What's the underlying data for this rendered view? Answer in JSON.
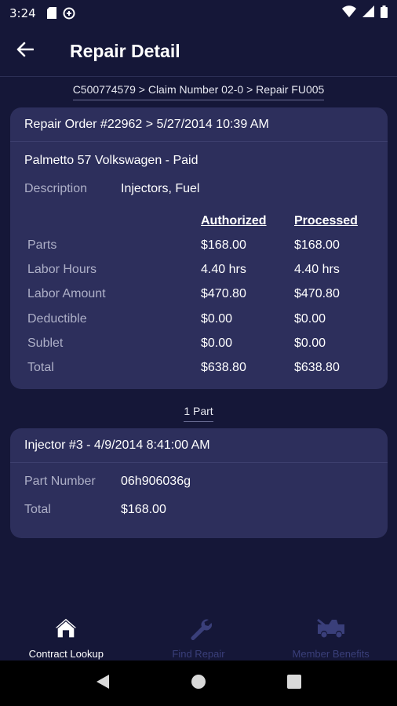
{
  "status_bar": {
    "time": "3:24"
  },
  "app_bar": {
    "title": "Repair Detail"
  },
  "breadcrumb": "C500774579 > Claim Number 02-0 > Repair FU005",
  "repair_order": {
    "header": "Repair Order #22962 > 5/27/2014 10:39 AM",
    "shop": "Palmetto 57 Volkswagen - Paid",
    "description_label": "Description",
    "description_value": "Injectors, Fuel",
    "columns": {
      "authorized": "Authorized",
      "processed": "Processed"
    },
    "rows": [
      {
        "label": "Parts",
        "authorized": "$168.00",
        "processed": "$168.00"
      },
      {
        "label": "Labor Hours",
        "authorized": "4.40 hrs",
        "processed": "4.40 hrs"
      },
      {
        "label": "Labor Amount",
        "authorized": "$470.80",
        "processed": "$470.80"
      },
      {
        "label": "Deductible",
        "authorized": "$0.00",
        "processed": "$0.00"
      },
      {
        "label": "Sublet",
        "authorized": "$0.00",
        "processed": "$0.00"
      },
      {
        "label": "Total",
        "authorized": "$638.80",
        "processed": "$638.80"
      }
    ]
  },
  "parts_section": {
    "label": "1 Part"
  },
  "part": {
    "header": "Injector #3 - 4/9/2014 8:41:00 AM",
    "part_number_label": "Part Number",
    "part_number_value": "06h906036g",
    "total_label": "Total",
    "total_value": "$168.00"
  },
  "bottom_nav": {
    "items": [
      {
        "label": "Contract Lookup",
        "icon": "home-icon",
        "active": true
      },
      {
        "label": "Find Repair",
        "icon": "wrench-icon",
        "active": false
      },
      {
        "label": "Member Benefits",
        "icon": "tow-truck-icon",
        "active": false
      }
    ]
  },
  "colors": {
    "background": "#151738",
    "card": "#2d2f5c",
    "muted_text": "#aeb0c8",
    "inactive_nav": "#3a3f7a"
  }
}
